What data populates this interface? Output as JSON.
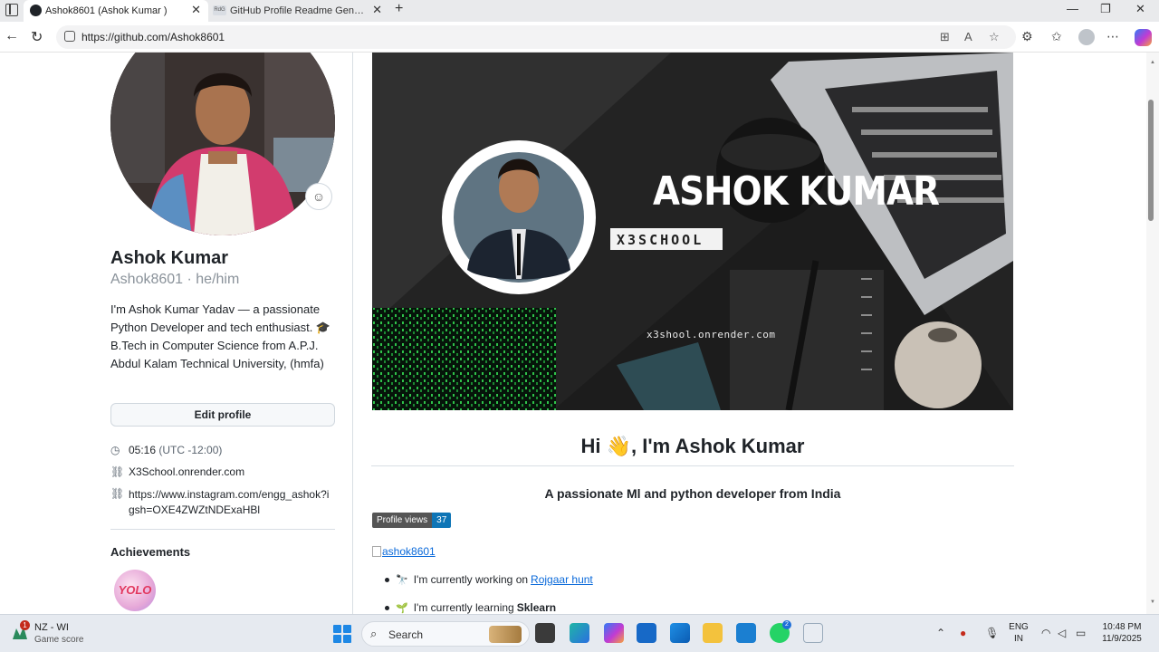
{
  "browser": {
    "tabs": [
      {
        "label": "Ashok8601 (Ashok Kumar )",
        "active": true
      },
      {
        "label": "GitHub Profile Readme Generator",
        "active": false
      }
    ],
    "url": "https://github.com/Ashok8601"
  },
  "profile": {
    "name": "Ashok Kumar",
    "handle": "Ashok8601 · he/him",
    "bio": "I'm Ashok Kumar Yadav — a passionate Python Developer and tech enthusiast. 🎓 B.Tech in Computer Science from A.P.J. Abdul Kalam Technical University, (hmfa)",
    "edit_label": "Edit profile",
    "local_time": "05:16",
    "timezone": "(UTC -12:00)",
    "website": "X3School.onrender.com",
    "instagram": "https://www.instagram.com/engg_ashok?igsh=OXE4ZWZtNDExaHBl",
    "achievements_title": "Achievements",
    "achievement_badge": "YOLO"
  },
  "readme": {
    "banner": {
      "title": "ASHOK KUMAR",
      "tag": "X3SCHOOL",
      "url": "x3shool.onrender.com"
    },
    "greeting": "Hi 👋, I'm Ashok Kumar",
    "subheading": "A passionate Ml and python developer from India",
    "profile_views_label": "Profile views",
    "profile_views_count": "37",
    "image_alt": "ashok8601",
    "items": [
      {
        "emoji": "🔭",
        "text": "I'm currently working on",
        "link": "Rojgaar hunt"
      },
      {
        "emoji": "🌱",
        "text": "I'm currently learning",
        "bold": "Sklearn"
      }
    ]
  },
  "taskbar": {
    "weather_title": "NZ - WI",
    "weather_subtitle": "Game score",
    "weather_badge": "1",
    "search_label": "Search",
    "whatsapp_badge": "2",
    "lang_top": "ENG",
    "lang_bottom": "IN",
    "time": "10:48 PM",
    "date": "11/9/2025"
  },
  "colors": {
    "link": "#0969da",
    "badge_blue": "#0e75b6",
    "badge_gray": "#555555"
  }
}
